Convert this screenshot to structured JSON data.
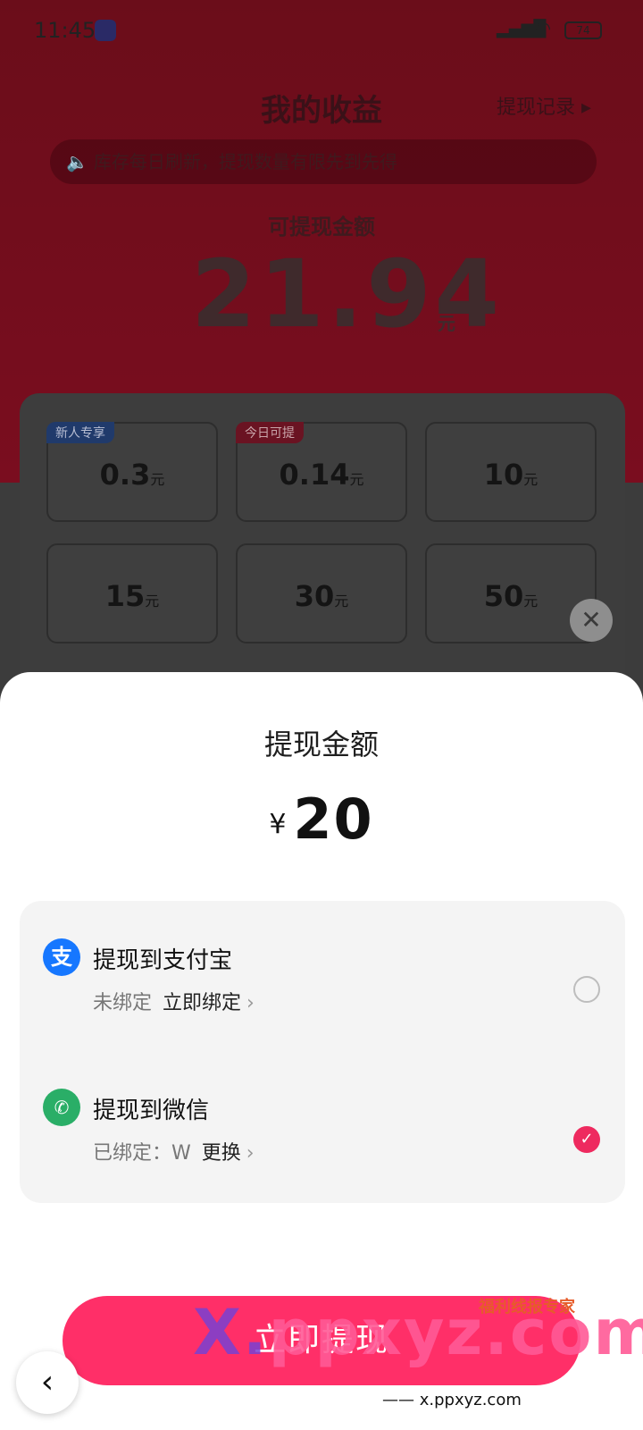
{
  "status": {
    "time": "11:45",
    "battery": "74"
  },
  "header": {
    "title": "我的收益",
    "history_link": "提现记录 ▸"
  },
  "notice": {
    "text": "库存每日刷新，提现数量有限先到先得"
  },
  "balance": {
    "label": "可提现金额",
    "amount": "21.94",
    "unit": "元"
  },
  "options": [
    {
      "value": "0.3",
      "unit": "元",
      "tag": "新人专享"
    },
    {
      "value": "0.14",
      "unit": "元",
      "tag": "今日可提"
    },
    {
      "value": "10",
      "unit": "元",
      "tag": ""
    },
    {
      "value": "15",
      "unit": "元",
      "tag": ""
    },
    {
      "value": "30",
      "unit": "元",
      "tag": ""
    },
    {
      "value": "50",
      "unit": "元",
      "tag": ""
    }
  ],
  "sheet": {
    "title": "提现金额",
    "currency": "¥",
    "amount": "20",
    "methods": [
      {
        "title": "提现到支付宝",
        "status": "未绑定",
        "action": "立即绑定",
        "selected": false,
        "icon": "alipay-icon"
      },
      {
        "title": "提现到微信",
        "status": "已绑定：W",
        "action": "更换",
        "selected": true,
        "icon": "wechat-icon"
      }
    ],
    "cta": "立即提现"
  },
  "watermark": {
    "main_a": "X.",
    "main_b": "ppxyz.com",
    "badge": "福利线报专家",
    "sub": "—— x.ppxyz.com"
  },
  "colors": {
    "accent": "#ff2f68",
    "alipay": "#1677ff",
    "wechat": "#2aae67"
  }
}
